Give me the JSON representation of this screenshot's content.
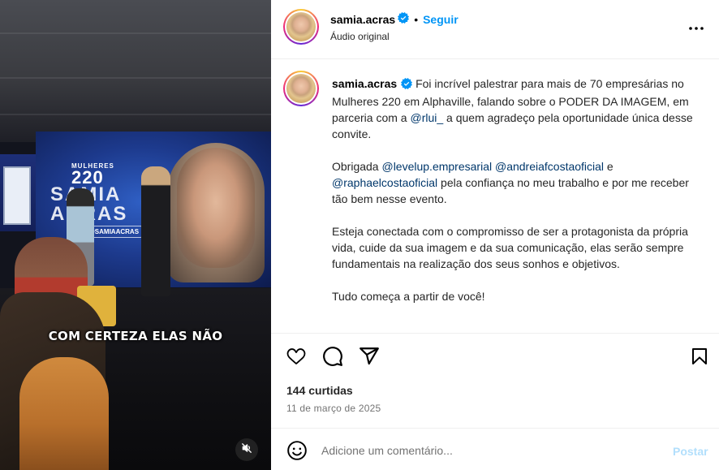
{
  "media": {
    "brand_small": "MULHERES",
    "brand_number": "220",
    "brand_name": "SAMIA ACRAS",
    "brand_tag": "@SAMIAACRAS",
    "caption_overlay": "COM CERTEZA ELAS NÃO",
    "mute_icon": "speaker-muted-icon"
  },
  "header": {
    "username": "samia.acras",
    "separator": "•",
    "follow_label": "Seguir",
    "subtitle": "Áudio original",
    "more_icon": "more-horizontal-icon"
  },
  "caption": {
    "username": "samia.acras",
    "p1_text": " Foi incrível palestrar para mais de 70 empresárias no Mulheres 220 em Alphaville, falando sobre o PODER DA IMAGEM, em parceria com a ",
    "p1_mention": "@rlui_",
    "p1_text_end": " a quem agradeço pela oportunidade única desse convite.",
    "p2_start": "Obrigada ",
    "p2_mention1": "@levelup.empresarial",
    "p2_space": " ",
    "p2_mention2": "@andreiafcostaoficial",
    "p2_and": " e ",
    "p2_mention3": "@raphaelcostaoficial",
    "p2_end": " pela confiança no meu trabalho e por me receber tão bem nesse evento.",
    "p3": "Esteja conectada com o compromisso de ser a protagonista da própria vida, cuide da sua imagem e da sua comunicação, elas serão sempre fundamentais na realização dos seus sonhos e objetivos.",
    "p4": "Tudo começa a partir de você!"
  },
  "actions": {
    "like_icon": "heart-icon",
    "comment_icon": "comment-icon",
    "share_icon": "send-icon",
    "save_icon": "bookmark-icon"
  },
  "stats": {
    "likes": "144 curtidas",
    "date": "11 de março de 2025"
  },
  "comment_bar": {
    "emoji_icon": "emoji-icon",
    "placeholder": "Adicione um comentário...",
    "post_label": "Postar"
  },
  "colors": {
    "accent": "#0095f6",
    "mention": "#00376b",
    "post_disabled": "#b2dffc",
    "muted_text": "#737373",
    "divider": "#efefef"
  }
}
